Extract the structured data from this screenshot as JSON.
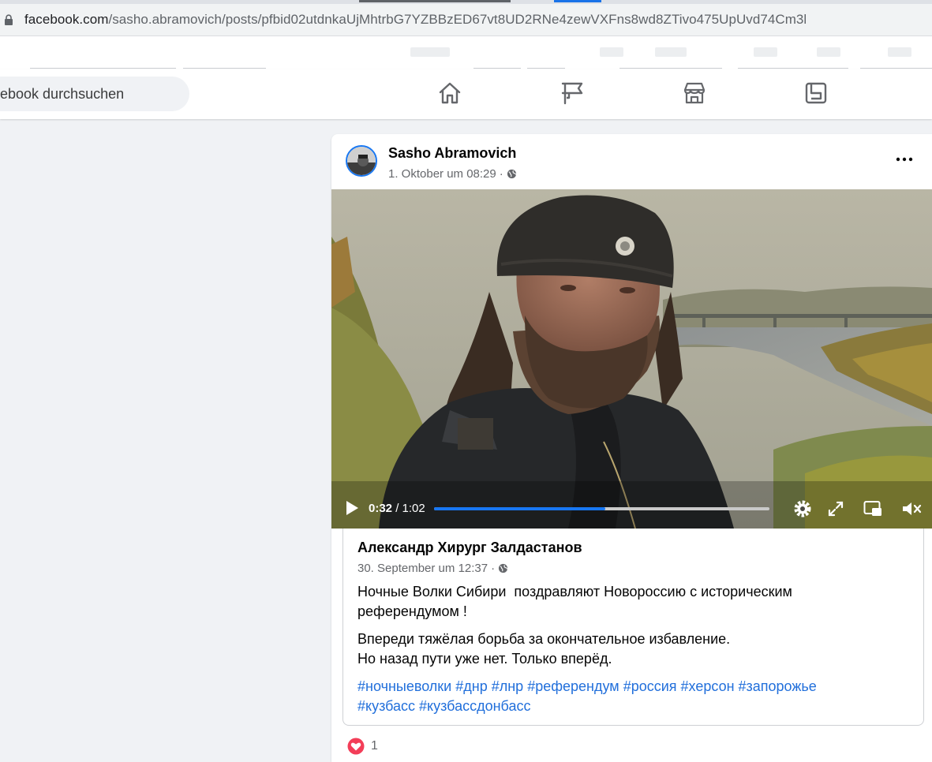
{
  "browser": {
    "url_host": "facebook.com",
    "url_path": "/sasho.abramovich/posts/pfbid02utdnkaUjMhtrbG7YZBBzED67vt8UD2RNe4zewVXFns8wd8ZTivo475UpUvd74Cm3l"
  },
  "nav": {
    "search_placeholder": "ebook durchsuchen",
    "icons": [
      "home-icon",
      "pages-flag-icon",
      "marketplace-icon",
      "gaming-icon"
    ]
  },
  "post": {
    "author": "Sasho Abramovich",
    "timestamp": "1. Oktober um 08:29",
    "separator": "·",
    "privacy_icon": "globe-icon",
    "more_icon": "more-options-icon",
    "video": {
      "current_time": "0:32",
      "time_separator": " / ",
      "duration": "1:02",
      "progress": 0.51,
      "icons": [
        "play-icon",
        "settings-icon",
        "fullscreen-icon",
        "picture-in-picture-icon",
        "muted-volume-icon"
      ]
    },
    "shared": {
      "author": "Александр Хирург Залдастанов",
      "timestamp": "30. September um 12:37",
      "separator": "·",
      "para1_line1": "Ночные Волки Сибири  поздравляют Новороссию с историческим",
      "para1_line2": "референдумом !",
      "para2_line1": "Впереди тяжёлая борьба за окончательное избавление.",
      "para2_line2": "Но назад пути уже нет. Только вперёд.",
      "hashtags": [
        "#ночныеволки",
        "#днр",
        "#лнр",
        "#референдум",
        "#россия",
        "#херсон",
        "#запорожье",
        "#кузбасс",
        "#кузбассдонбасс"
      ]
    },
    "reactions": {
      "icon": "love-reaction-icon",
      "count": "1"
    }
  },
  "colors": {
    "fb_blue": "#1877f2",
    "link": "#216fdb",
    "love": "#f33e58"
  }
}
